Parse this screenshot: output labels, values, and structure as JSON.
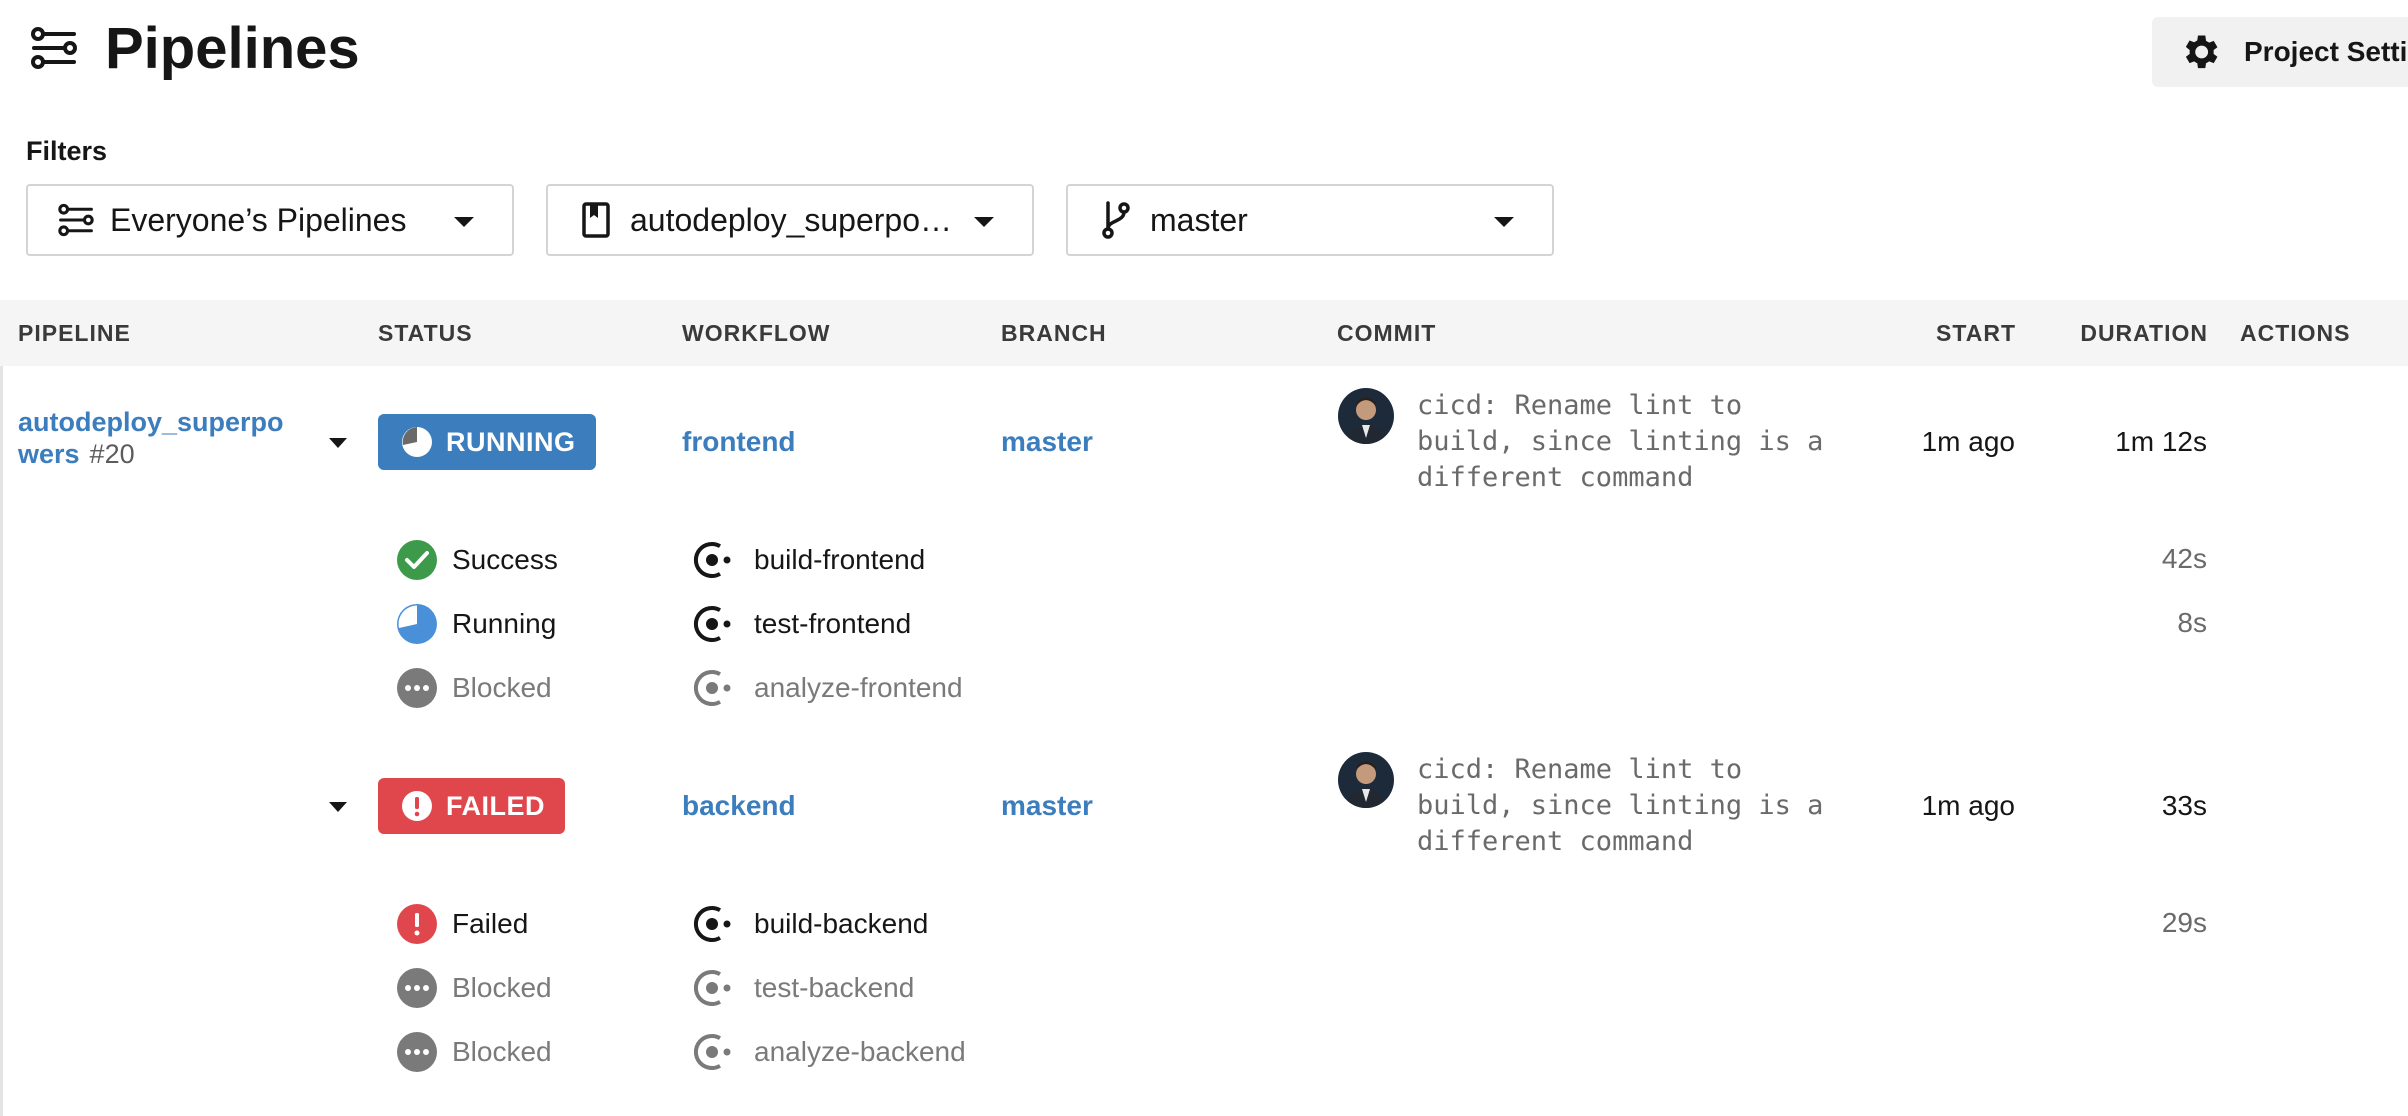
{
  "header": {
    "title": "Pipelines",
    "settings_label": "Project Settings"
  },
  "filters": {
    "label": "Filters",
    "pipelines_scope": "Everyone’s Pipelines",
    "project": "autodeploy_superpowers",
    "branch": "master"
  },
  "table": {
    "columns": {
      "pipeline": "PIPELINE",
      "status": "STATUS",
      "workflow": "WORKFLOW",
      "branch": "BRANCH",
      "commit": "COMMIT",
      "start": "START",
      "duration": "DURATION",
      "actions": "ACTIONS"
    }
  },
  "pipeline": {
    "name": "autodeploy_superpowers",
    "number": "#20"
  },
  "workflows": [
    {
      "status": "RUNNING",
      "name": "frontend",
      "branch": "master",
      "commit": "cicd: Rename lint to build, since linting is a different command",
      "start": "1m ago",
      "duration": "1m 12s",
      "jobs": [
        {
          "status": "Success",
          "name": "build-frontend",
          "duration": "42s"
        },
        {
          "status": "Running",
          "name": "test-frontend",
          "duration": "8s"
        },
        {
          "status": "Blocked",
          "name": "analyze-frontend",
          "duration": ""
        }
      ]
    },
    {
      "status": "FAILED",
      "name": "backend",
      "branch": "master",
      "commit": "cicd: Rename lint to build, since linting is a different command",
      "start": "1m ago",
      "duration": "33s",
      "jobs": [
        {
          "status": "Failed",
          "name": "build-backend",
          "duration": "29s"
        },
        {
          "status": "Blocked",
          "name": "test-backend",
          "duration": ""
        },
        {
          "status": "Blocked",
          "name": "analyze-backend",
          "duration": ""
        }
      ]
    }
  ],
  "colors": {
    "link": "#3b7dbd",
    "running": "#3b7dbd",
    "failed": "#e0474c",
    "success": "#3d9a4a",
    "blocked": "#787878"
  },
  "icons": {
    "header": "pipelines-icon",
    "settings": "gear-icon",
    "project": "bookmark-icon",
    "branch": "git-branch-icon",
    "job": "job-icon"
  }
}
